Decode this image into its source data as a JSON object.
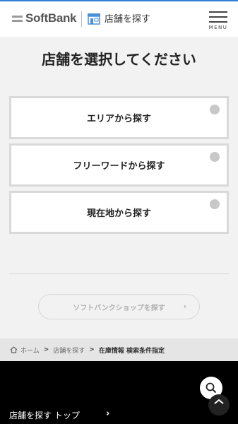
{
  "header": {
    "logo_text": "SoftBank",
    "store_label": "店舗を探す",
    "menu_label": "MENU"
  },
  "main": {
    "title": "店舗を選択してください",
    "options": [
      {
        "label": "エリアから探す"
      },
      {
        "label": "フリーワードから探す"
      },
      {
        "label": "現在地から探す"
      }
    ],
    "softbank_shop_button": "ソフトバンクショップを探す"
  },
  "breadcrumb": {
    "home": "ホーム",
    "store": "店舗を探す",
    "current": "在庫情報 検索条件指定",
    "separator": ">"
  },
  "footer": {
    "link_label": "店舗を探す トップ"
  },
  "colors": {
    "accent_line": "#2f7fd6",
    "footer_bg": "#000000",
    "page_bg": "#f2f2f2"
  }
}
